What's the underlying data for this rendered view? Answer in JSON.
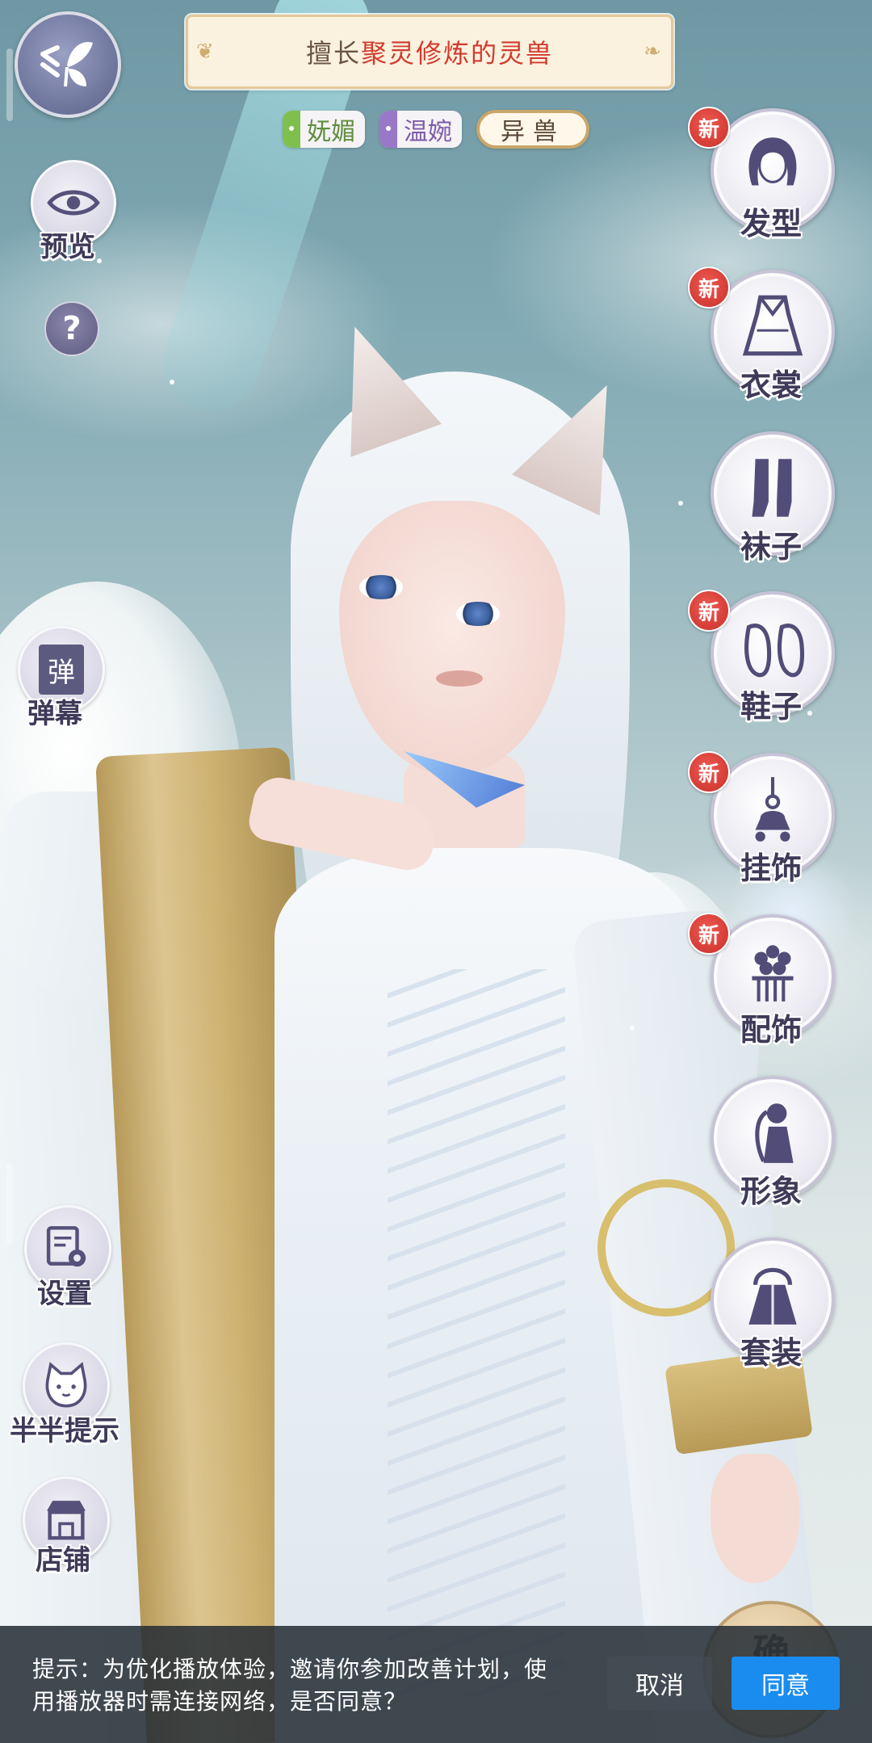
{
  "header": {
    "title_prefix": "擅长",
    "title_highlight": "聚灵修炼的灵兽",
    "tags": [
      "妩媚",
      "温婉"
    ],
    "type_tag": "异兽"
  },
  "left_menu": {
    "preview_label": "预览",
    "help_label": "?",
    "danmaku_icon_text": "弹",
    "danmaku_label": "弹幕",
    "settings_label": "设置",
    "hint_label": "半半提示",
    "shop_label": "店铺"
  },
  "right_menu": {
    "new_badge": "新",
    "items": [
      {
        "label": "发型",
        "icon": "hairstyle-icon",
        "is_new": true
      },
      {
        "label": "衣裳",
        "icon": "clothing-icon",
        "is_new": true
      },
      {
        "label": "袜子",
        "icon": "socks-icon",
        "is_new": false
      },
      {
        "label": "鞋子",
        "icon": "shoes-icon",
        "is_new": true
      },
      {
        "label": "挂饰",
        "icon": "pendant-icon",
        "is_new": true
      },
      {
        "label": "配饰",
        "icon": "accessory-icon",
        "is_new": true
      },
      {
        "label": "形象",
        "icon": "appearance-icon",
        "is_new": false
      },
      {
        "label": "套装",
        "icon": "outfit-set-icon",
        "is_new": false
      }
    ]
  },
  "confirm_peek": "确",
  "dialog": {
    "message": "提示：为优化播放体验，邀请你参加改善计划，使用播放器时需连接网络，是否同意？",
    "cancel_label": "取消",
    "agree_label": "同意"
  },
  "colors": {
    "highlight": "#d23a2c",
    "agree_button": "#1a8cf0",
    "new_badge": "#d8332c",
    "label_text": "#3e3a58"
  }
}
